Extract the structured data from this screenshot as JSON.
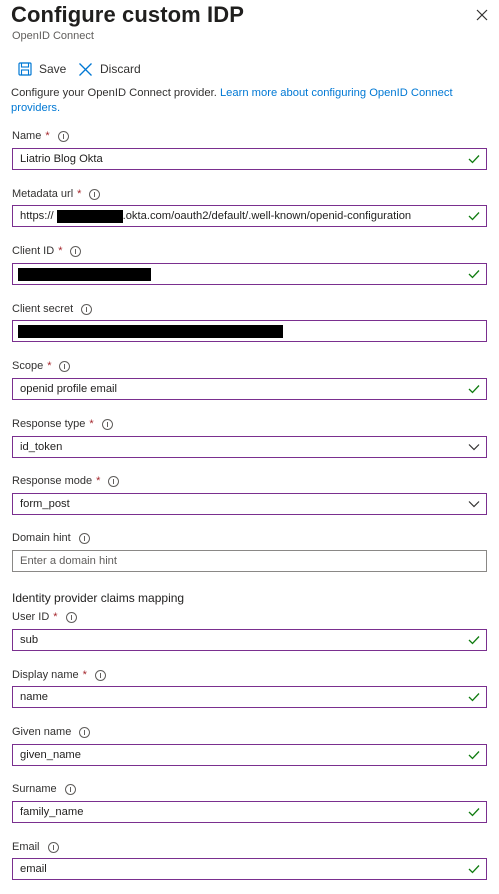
{
  "header": {
    "title": "Configure custom IDP",
    "subtitle": "OpenID Connect"
  },
  "toolbar": {
    "save_label": "Save",
    "discard_label": "Discard"
  },
  "description": {
    "text": "Configure your OpenID Connect provider. ",
    "link": "Learn more about configuring OpenID Connect providers."
  },
  "fields": {
    "name": {
      "label": "Name",
      "value": "Liatrio Blog Okta",
      "required": "*"
    },
    "metadata_url": {
      "label": "Metadata url",
      "prefix": "https://",
      "suffix": ".okta.com/oauth2/default/.well-known/openid-configuration",
      "required": "*"
    },
    "client_id": {
      "label": "Client ID",
      "required": "*"
    },
    "client_secret": {
      "label": "Client secret"
    },
    "scope": {
      "label": "Scope",
      "value": "openid profile email",
      "required": "*"
    },
    "response_type": {
      "label": "Response type",
      "value": "id_token",
      "required": "*"
    },
    "response_mode": {
      "label": "Response mode",
      "value": "form_post",
      "required": "*"
    },
    "domain_hint": {
      "label": "Domain hint",
      "placeholder": "Enter a domain hint"
    }
  },
  "claims": {
    "section_title": "Identity provider claims mapping",
    "user_id": {
      "label": "User ID",
      "value": "sub",
      "required": "*"
    },
    "display_name": {
      "label": "Display name",
      "value": "name",
      "required": "*"
    },
    "given_name": {
      "label": "Given name",
      "value": "given_name"
    },
    "surname": {
      "label": "Surname",
      "value": "family_name"
    },
    "email": {
      "label": "Email",
      "value": "email"
    }
  },
  "colors": {
    "accent": "#0078d4",
    "field_border_active": "#7a2f8f",
    "required": "#a4262c",
    "valid_check": "#107c10"
  },
  "icons": [
    "close-icon",
    "save-icon",
    "discard-icon",
    "info-icon",
    "check-icon",
    "chevron-down-icon"
  ]
}
